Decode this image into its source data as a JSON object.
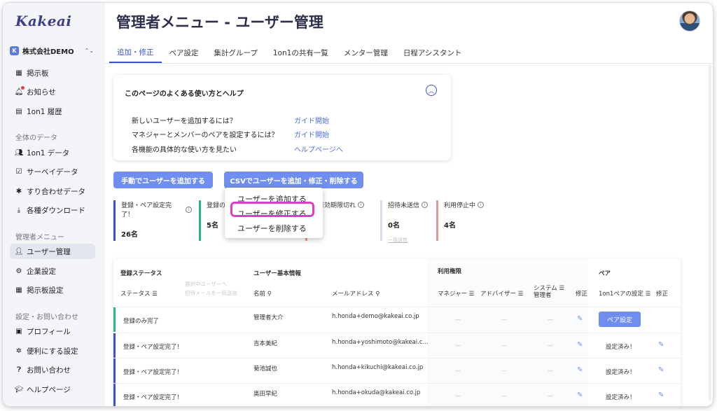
{
  "sidebar": {
    "logo": "Kakeai",
    "company": "株式会社DEMO",
    "company_badge": "K",
    "items_top": [
      {
        "label": "掲示板",
        "icon": "bulletin-icon"
      },
      {
        "label": "お知らせ",
        "icon": "bell-icon"
      },
      {
        "label": "1on1 履歴",
        "icon": "history-icon"
      }
    ],
    "section_data": "全体のデータ",
    "items_data": [
      {
        "label": "1on1 データ",
        "icon": "people-icon"
      },
      {
        "label": "サーベイデータ",
        "icon": "survey-icon"
      },
      {
        "label": "すり合わせデータ",
        "icon": "puzzle-icon"
      },
      {
        "label": "各種ダウンロード",
        "icon": "download-icon"
      }
    ],
    "section_admin": "管理者メニュー",
    "items_admin": [
      {
        "label": "ユーザー管理",
        "icon": "users-icon",
        "active": true
      },
      {
        "label": "企業設定",
        "icon": "company-icon"
      },
      {
        "label": "掲示板設定",
        "icon": "board-settings-icon"
      }
    ],
    "section_settings": "設定・お問い合わせ",
    "items_settings": [
      {
        "label": "プロフィール",
        "icon": "profile-icon"
      },
      {
        "label": "便利にする設定",
        "icon": "gear-icon"
      },
      {
        "label": "お問い合わせ",
        "icon": "question-icon"
      },
      {
        "label": "ヘルプページ",
        "icon": "graduation-icon"
      }
    ]
  },
  "header": {
    "title": "管理者メニュー - ユーザー管理"
  },
  "tabs": [
    "追加・修正",
    "ペア設定",
    "集計グループ",
    "1on1の共有一覧",
    "メンター管理",
    "日程アシスタント"
  ],
  "help": {
    "title": "このページのよくある使い方とヘルプ",
    "rows": [
      {
        "q": "新しいユーザーを追加するには？",
        "link": "ガイド開始"
      },
      {
        "q": "マネジャーとメンバーのペアを設定するには？",
        "link": "ガイド開始"
      },
      {
        "q": "各機能の具体的な使い方を見たい",
        "link": "ヘルプページへ"
      }
    ]
  },
  "buttons": {
    "manual_add": "手動でユーザーを追加する",
    "csv": "CSVでユーザーを追加・修正・削除する"
  },
  "stats": [
    {
      "label": "登録・ペア設定完了！",
      "value": "26名",
      "sub": ""
    },
    {
      "label": "登録の",
      "value": "5名",
      "sub": ""
    },
    {
      "label": "待有効期限切れ",
      "value": "",
      "sub": ""
    },
    {
      "label": "招待未送信",
      "value": "0名",
      "sub": "一括送信"
    },
    {
      "label": "利用停止中",
      "value": "4名",
      "sub": ""
    }
  ],
  "dropdown": [
    "ユーザーを追加する",
    "ユーザーを修正する",
    "ユーザーを削除する"
  ],
  "table": {
    "group_status": "登録ステータス",
    "group_basic": "ユーザー基本情報",
    "group_perm": "利用権限",
    "group_pair": "ペア",
    "col_status": "ステータス",
    "faint_1": "選択中ユーザーへ",
    "faint_2": "招待メールを一括送信",
    "col_name": "名前",
    "col_email": "メールアドレス",
    "col_manager": "マネジャー",
    "col_advisor": "アドバイザー",
    "col_sys1": "システム",
    "col_sys2": "管理者",
    "col_edit": "修正",
    "col_pair": "1on1ペアの設定",
    "col_pair_edit": "修正",
    "pair_button": "ペア設定",
    "rows": [
      {
        "status": "登録のみ完了",
        "name": "管理者大介",
        "email": "h.honda+demo@kakeai.co.jp",
        "pair": "",
        "color": "#2bb38a"
      },
      {
        "status": "登録・ペア設定完了！",
        "name": "吉本美紀",
        "email": "h.honda+yoshimoto@kakeai.c...",
        "pair": "設定済み！",
        "color": "#3b53c7"
      },
      {
        "status": "登録・ペア設定完了！",
        "name": "菊池誠也",
        "email": "h.honda+kikuchi@kakeai.co.jp",
        "pair": "設定済み！",
        "color": "#3b53c7"
      },
      {
        "status": "登録・ペア設定完了！",
        "name": "奥田早紀",
        "email": "h.honda+okuda@kakeai.co.jp",
        "pair": "設定済み！",
        "color": "#3b53c7"
      }
    ],
    "dash": "—"
  }
}
